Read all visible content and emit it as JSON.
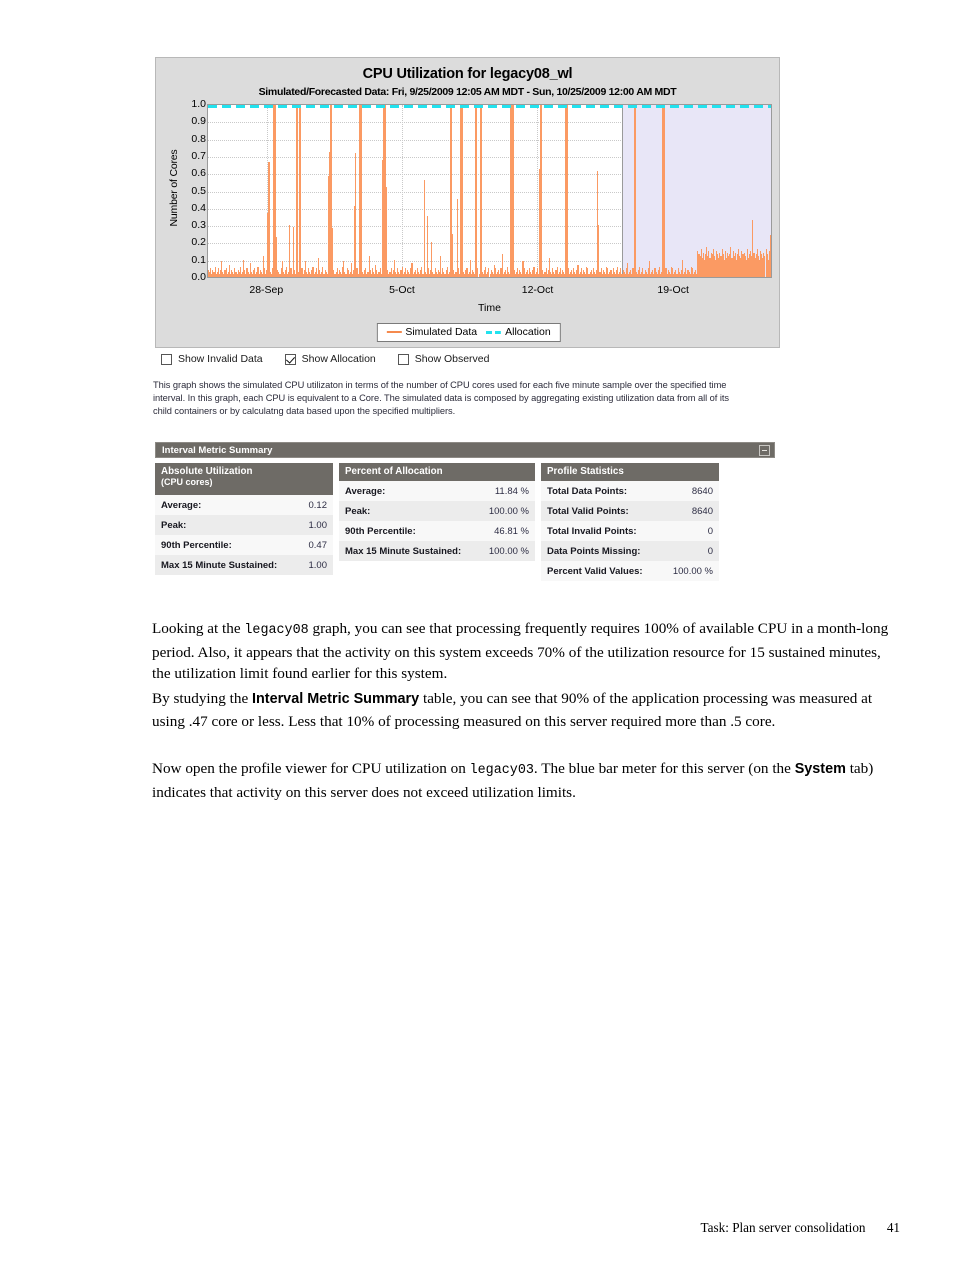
{
  "chart_panel": {
    "title": "CPU Utilization for legacy08_wl",
    "subtitle": "Simulated/Forecasted Data: Fri, 9/25/2009 12:05 AM MDT - Sun, 10/25/2009 12:00 AM MDT"
  },
  "chart_data": {
    "type": "area",
    "title": "CPU Utilization for legacy08_wl",
    "subtitle": "Simulated/Forecasted Data: Fri, 9/25/2009 12:05 AM MDT - Sun, 10/25/2009 12:00 AM MDT",
    "xlabel": "Time",
    "ylabel": "Number of Cores",
    "ylim": [
      0.0,
      1.0
    ],
    "ytick_labels": [
      "1.0",
      "0.9",
      "0.8",
      "0.7",
      "0.6",
      "0.5",
      "0.4",
      "0.3",
      "0.2",
      "0.1",
      "0.0"
    ],
    "xtick_labels": [
      "28-Sep",
      "5-Oct",
      "12-Oct",
      "19-Oct"
    ],
    "xtick_positions_pct": [
      10.5,
      34.5,
      58.5,
      82.5
    ],
    "grid": true,
    "legend_position": "bottom",
    "legend": [
      {
        "name": "Simulated Data",
        "color": "#f58a4e",
        "style": "solid"
      },
      {
        "name": "Allocation",
        "color": "#22e2ee",
        "style": "dashed"
      }
    ],
    "series": [
      {
        "name": "Allocation",
        "type": "hline",
        "value": 1.0,
        "color": "#22e2ee"
      },
      {
        "name": "Simulated Data",
        "type": "area",
        "color": "#fb9a63",
        "values": [
          0.04,
          0.03,
          0.05,
          0.02,
          0.04,
          0.03,
          0.06,
          0.02,
          0.03,
          0.05,
          0.02,
          0.04,
          0.09,
          0.03,
          0.02,
          0.04,
          0.05,
          0.02,
          0.03,
          0.07,
          0.02,
          0.04,
          0.03,
          0.02,
          0.05,
          0.03,
          0.02,
          0.04,
          0.03,
          0.06,
          0.02,
          0.03,
          0.1,
          0.04,
          0.02,
          0.05,
          0.03,
          0.02,
          0.08,
          0.03,
          0.02,
          0.04,
          0.05,
          0.02,
          0.03,
          0.06,
          0.02,
          0.04,
          0.03,
          0.02,
          0.12,
          0.05,
          0.02,
          0.04,
          0.37,
          0.66,
          0.03,
          0.02,
          0.05,
          1.0,
          1.0,
          1.0,
          0.23,
          0.04,
          0.03,
          0.02,
          0.05,
          0.09,
          0.03,
          0.02,
          0.04,
          0.06,
          0.02,
          0.03,
          0.3,
          0.05,
          0.02,
          0.29,
          0.04,
          0.02,
          1.0,
          1.0,
          0.03,
          1.0,
          1.0,
          0.05,
          0.02,
          0.04,
          0.09,
          0.03,
          0.02,
          0.05,
          0.03,
          0.02,
          0.04,
          0.06,
          0.02,
          0.03,
          0.05,
          0.02,
          0.11,
          0.04,
          0.02,
          0.03,
          0.06,
          0.02,
          0.04,
          0.03,
          0.02,
          0.58,
          0.72,
          1.0,
          1.0,
          0.28,
          0.04,
          0.02,
          0.03,
          0.05,
          0.02,
          0.04,
          0.03,
          0.02,
          0.06,
          0.09,
          0.03,
          0.02,
          0.05,
          0.04,
          0.02,
          0.03,
          0.08,
          0.02,
          0.04,
          0.41,
          0.71,
          0.05,
          0.02,
          1.0,
          1.0,
          0.99,
          0.03,
          0.02,
          0.04,
          0.05,
          0.02,
          0.03,
          0.12,
          0.04,
          0.02,
          0.05,
          0.03,
          0.02,
          0.07,
          0.04,
          0.02,
          0.03,
          0.05,
          0.02,
          0.67,
          1.0,
          1.0,
          1.0,
          0.52,
          0.04,
          0.02,
          0.03,
          0.05,
          0.02,
          0.04,
          0.1,
          0.03,
          0.02,
          0.05,
          0.03,
          0.02,
          0.04,
          0.06,
          0.02,
          0.03,
          0.05,
          0.02,
          0.04,
          0.03,
          0.02,
          0.05,
          0.08,
          0.02,
          0.03,
          0.04,
          0.02,
          0.05,
          0.03,
          0.02,
          0.04,
          0.06,
          0.02,
          0.56,
          0.03,
          0.02,
          0.35,
          0.05,
          0.02,
          0.04,
          0.2,
          0.03,
          0.02,
          0.05,
          0.03,
          0.02,
          0.04,
          0.03,
          0.12,
          0.02,
          0.05,
          0.03,
          0.02,
          0.04,
          0.06,
          0.02,
          0.03,
          1.0,
          1.0,
          0.25,
          0.04,
          0.02,
          0.03,
          0.45,
          0.05,
          0.02,
          1.0,
          1.0,
          1.0,
          0.03,
          0.02,
          0.04,
          0.05,
          0.02,
          0.03,
          0.1,
          0.02,
          0.04,
          0.03,
          0.02,
          1.0,
          1.0,
          0.05,
          0.02,
          1.0,
          1.0,
          0.03,
          0.02,
          0.04,
          0.06,
          0.02,
          0.03,
          0.05,
          0.02,
          0.04,
          0.03,
          0.02,
          0.07,
          0.05,
          0.02,
          0.03,
          0.04,
          0.02,
          0.05,
          0.13,
          0.02,
          0.03,
          0.04,
          0.02,
          0.06,
          0.03,
          0.02,
          1.0,
          1.0,
          1.0,
          0.04,
          0.02,
          0.03,
          0.05,
          0.02,
          0.04,
          0.03,
          0.02,
          0.09,
          0.05,
          0.02,
          0.03,
          0.04,
          0.02,
          0.05,
          0.03,
          0.02,
          0.04,
          0.06,
          0.02,
          0.03,
          0.05,
          0.02,
          0.62,
          1.0,
          1.0,
          0.04,
          0.02,
          0.03,
          0.05,
          0.02,
          0.04,
          0.11,
          0.03,
          0.02,
          0.05,
          0.03,
          0.02,
          0.04,
          0.06,
          0.02,
          0.03,
          0.05,
          0.02,
          0.04,
          0.03,
          0.02,
          1.0,
          1.0,
          0.05,
          0.02,
          0.03,
          0.04,
          0.02,
          0.05,
          0.03,
          0.02,
          0.04,
          0.07,
          0.02,
          0.03,
          0.05,
          0.02,
          0.04,
          0.03,
          0.02,
          0.06,
          0.05,
          0.02,
          0.03,
          0.04,
          0.02,
          0.05,
          0.03,
          0.02,
          0.04,
          0.61,
          0.3,
          0.03,
          0.05,
          0.02,
          0.04,
          0.03,
          0.02,
          0.06,
          0.05,
          0.02,
          0.03,
          0.04,
          0.02,
          0.05,
          0.03,
          0.02,
          0.04,
          0.06,
          0.02,
          0.03,
          0.05,
          0.02,
          0.04,
          0.03,
          0.02,
          0.05,
          0.08,
          0.02,
          0.03,
          0.04,
          0.02,
          0.05,
          1.0,
          1.0,
          0.03,
          0.02,
          0.04,
          0.06,
          0.02,
          0.03,
          0.05,
          0.02,
          0.04,
          0.03,
          0.02,
          0.05,
          0.09,
          0.02,
          0.03,
          0.04,
          0.02,
          0.05,
          0.03,
          0.02,
          0.04,
          0.06,
          0.02,
          0.03,
          1.0,
          1.0,
          1.0,
          0.05,
          0.02,
          0.04,
          0.03,
          0.02,
          0.06,
          0.05,
          0.02,
          0.03,
          0.04,
          0.02,
          0.05,
          0.03,
          0.02,
          0.04,
          0.1,
          0.02,
          0.03,
          0.05,
          0.02,
          0.04,
          0.03,
          0.02,
          0.06,
          0.05,
          0.02,
          0.03,
          0.04,
          0.02,
          0.15,
          0.13,
          0.12,
          0.16,
          0.11,
          0.14,
          0.1,
          0.13,
          0.17,
          0.12,
          0.15,
          0.11,
          0.14,
          0.13,
          0.16,
          0.12,
          0.1,
          0.15,
          0.13,
          0.11,
          0.14,
          0.12,
          0.16,
          0.13,
          0.1,
          0.15,
          0.11,
          0.14,
          0.12,
          0.13,
          0.17,
          0.11,
          0.15,
          0.12,
          0.14,
          0.1,
          0.13,
          0.16,
          0.12,
          0.11,
          0.15,
          0.13,
          0.14,
          0.12,
          0.1,
          0.16,
          0.11,
          0.13,
          0.15,
          0.12,
          0.33,
          0.14,
          0.11,
          0.13,
          0.16,
          0.12,
          0.1,
          0.15,
          0.13,
          0.11,
          0.14,
          0.12,
          0.16,
          0.13,
          0.1,
          0.15,
          0.24
        ]
      }
    ],
    "forecast_band": {
      "start_pct": 73.5,
      "end_pct": 100,
      "color": "#e8e6f7"
    }
  },
  "checkboxes": [
    {
      "label": "Show Invalid Data",
      "checked": false
    },
    {
      "label": "Show Allocation",
      "checked": true
    },
    {
      "label": "Show Observed",
      "checked": false
    }
  ],
  "graph_description": "This graph shows the simulated CPU utilizaton in terms of the number of CPU cores used for each five minute sample over the specified time interval. In this graph, each CPU is equivalent to a Core. The simulated data is composed by aggregating existing utilization data from all of its child containers or by calculatng data based upon the specified multipliers.",
  "interval_metric_summary": {
    "panel_title": "Interval Metric Summary",
    "collapse_icon": "minimize-icon",
    "columns": [
      {
        "header": "Absolute Utilization",
        "subheader": "(CPU cores)",
        "rows": [
          {
            "label": "Average:",
            "value": "0.12"
          },
          {
            "label": "Peak:",
            "value": "1.00"
          },
          {
            "label": "90th Percentile:",
            "value": "0.47"
          },
          {
            "label": "Max 15 Minute Sustained:",
            "value": "1.00"
          }
        ]
      },
      {
        "header": "Percent of Allocation",
        "subheader": "",
        "rows": [
          {
            "label": "Average:",
            "value": "11.84 %"
          },
          {
            "label": "Peak:",
            "value": "100.00 %"
          },
          {
            "label": "90th Percentile:",
            "value": "46.81 %"
          },
          {
            "label": "Max 15 Minute Sustained:",
            "value": "100.00 %"
          }
        ]
      },
      {
        "header": "Profile Statistics",
        "subheader": "",
        "rows": [
          {
            "label": "Total Data Points:",
            "value": "8640"
          },
          {
            "label": "Total Valid Points:",
            "value": "8640"
          },
          {
            "label": "Total Invalid Points:",
            "value": "0"
          },
          {
            "label": "Data Points Missing:",
            "value": "0"
          },
          {
            "label": "Percent Valid Values:",
            "value": "100.00 %"
          }
        ]
      }
    ]
  },
  "prose": {
    "para_1_a": "Looking at the ",
    "para_1_mono": "legacy08",
    "para_1_b": " graph, you can see that processing frequently requires 100% of available CPU in a month-long period. Also, it appears that the activity on this system exceeds 70% of the utilization resource for 15 sustained minutes, the utilization limit found earlier for this system.",
    "para_2_a": "By studying the ",
    "para_2_bold": "Interval Metric Summary",
    "para_2_b": " table, you can see that 90% of the application processing was measured at using .47 core or less. Less that 10% of processing measured on this server required more than .5 core.",
    "para_3_a": "Now open the profile viewer for CPU utilization on ",
    "para_3_mono": "legacy03",
    "para_3_b": ". The blue bar meter for this server (on the ",
    "para_3_bold": "System",
    "para_3_c": " tab) indicates that activity on this server does not exceed utilization limits."
  },
  "footer": {
    "task": "Task: Plan server consolidation",
    "page": "41"
  }
}
